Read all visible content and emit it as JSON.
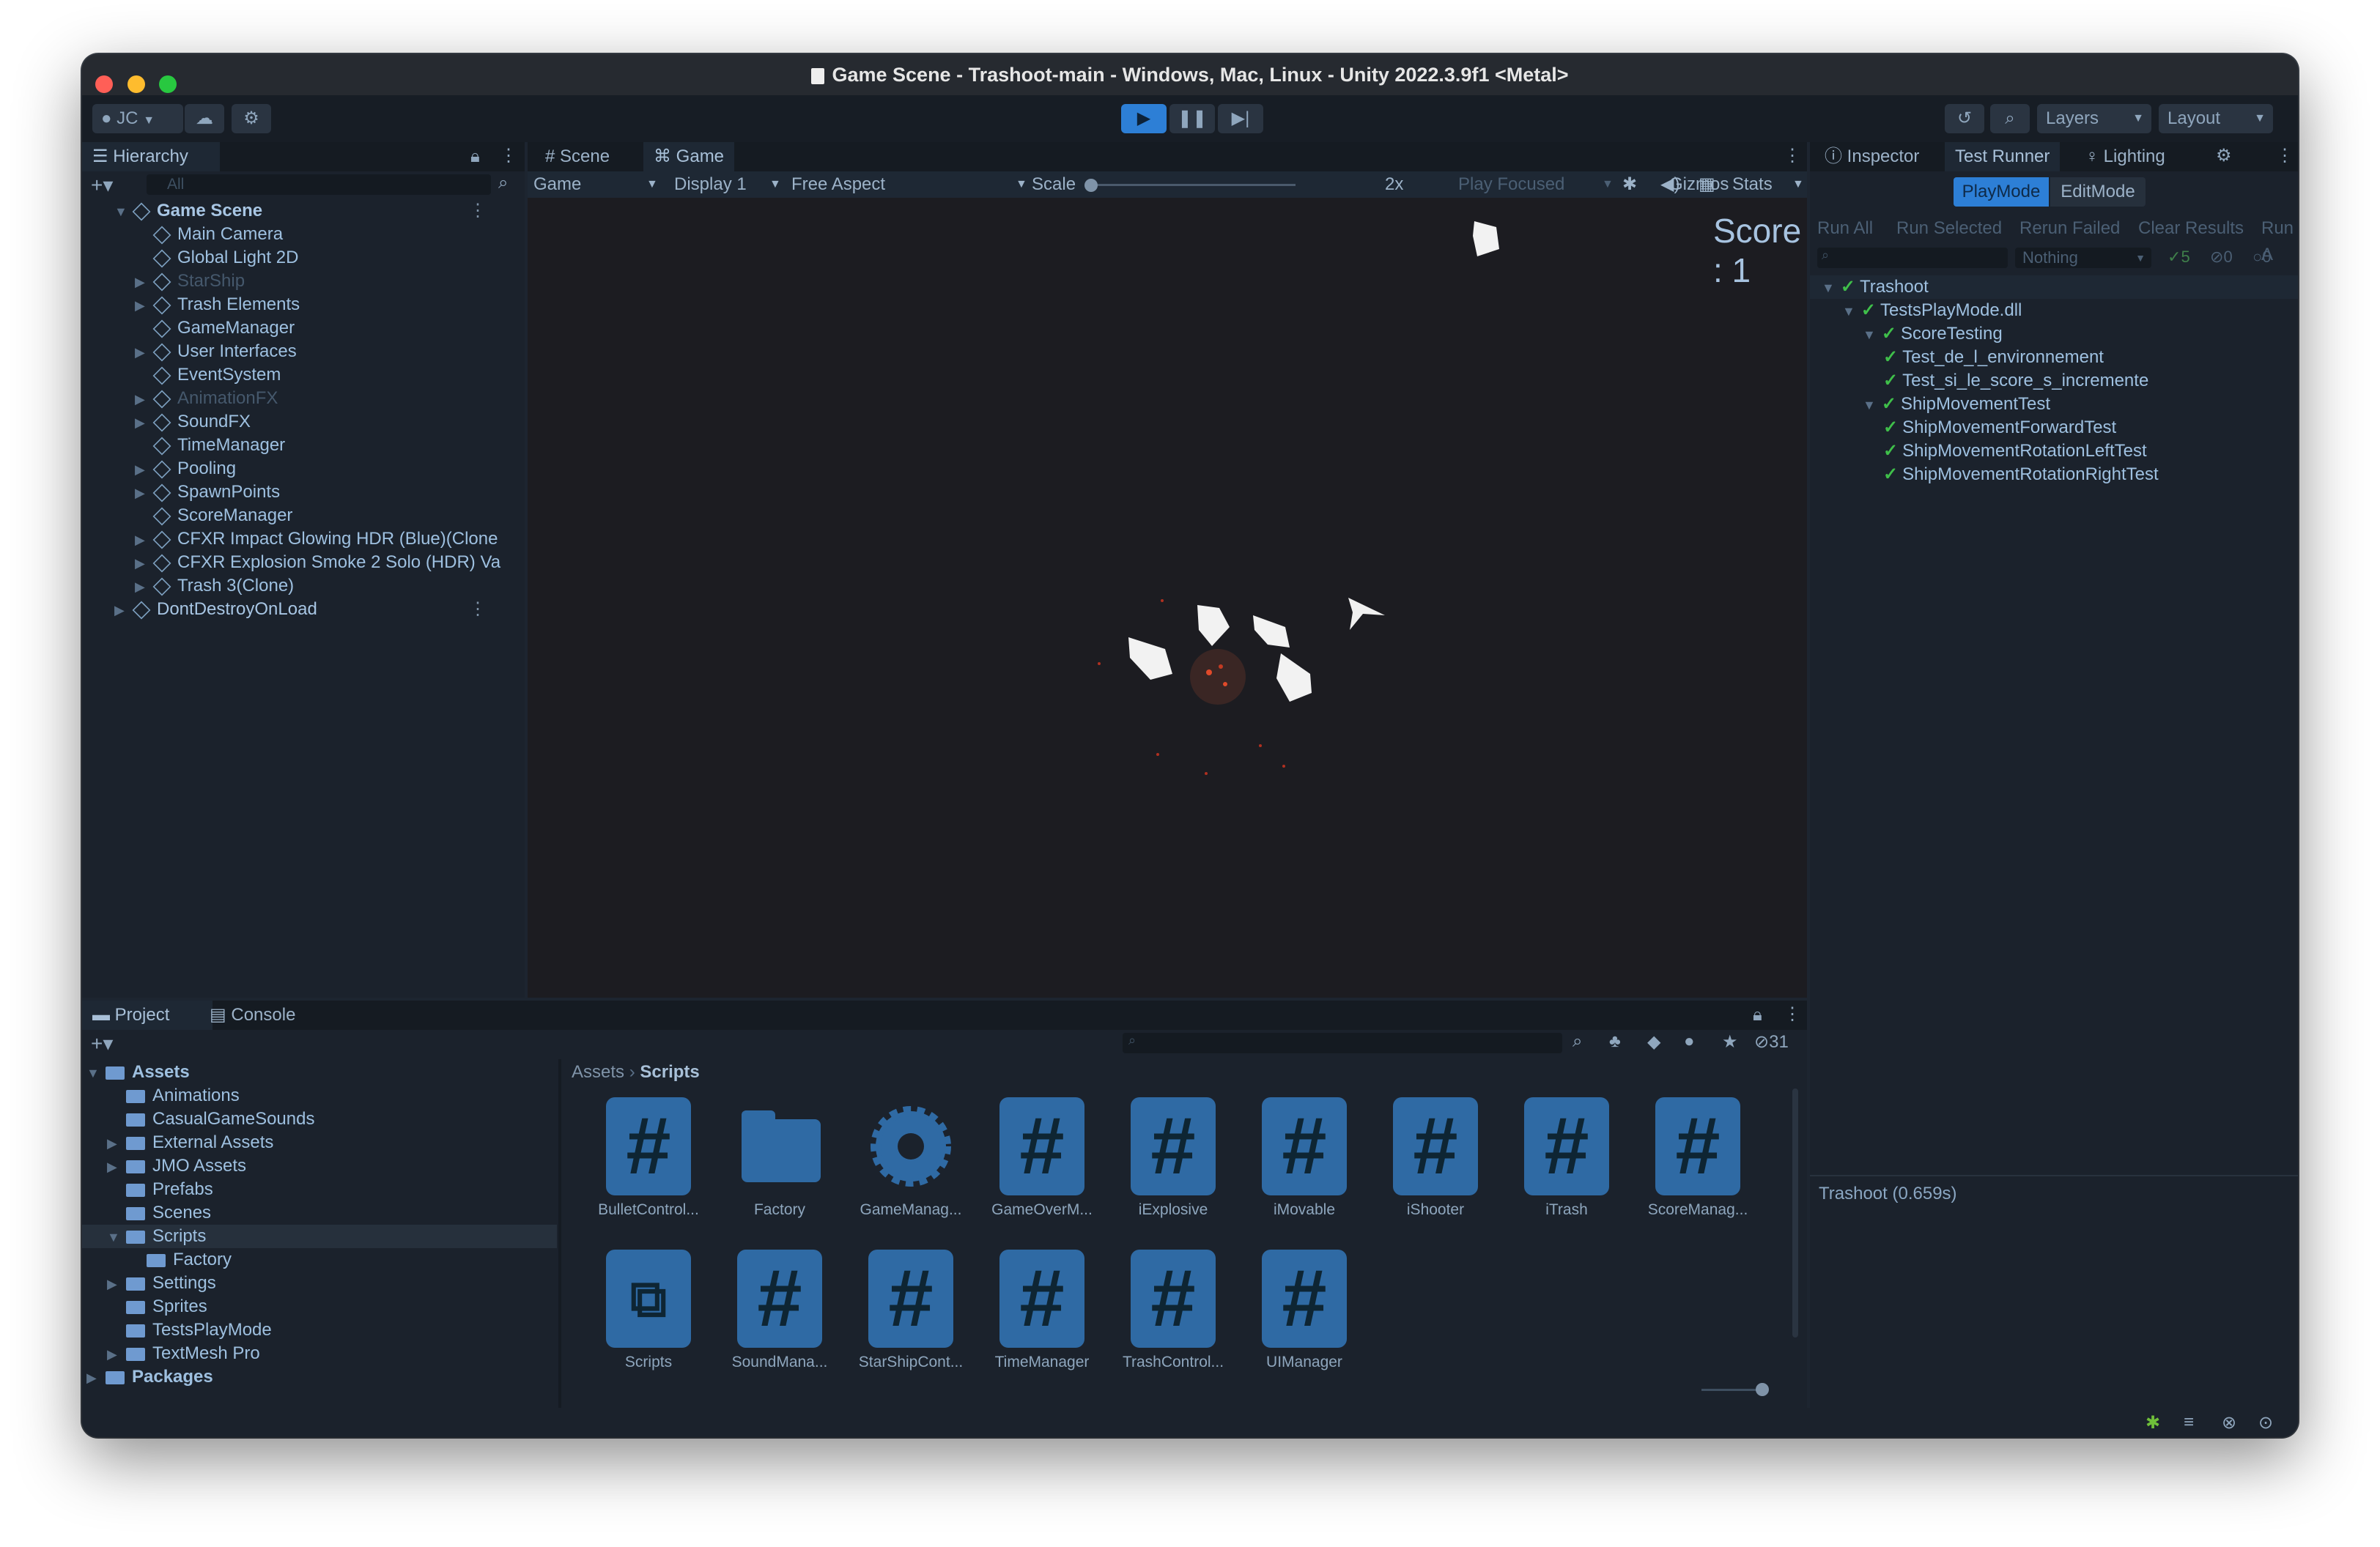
{
  "window": {
    "title": "Game Scene - Trashoot-main - Windows, Mac, Linux - Unity 2022.3.9f1 <Metal>"
  },
  "toolbar": {
    "account": "JC",
    "layers": "Layers",
    "layout": "Layout"
  },
  "hierarchy": {
    "tab": "Hierarchy",
    "search_placeholder": "All",
    "items": [
      {
        "label": "Game Scene",
        "depth": 0,
        "bold": true,
        "dim": false
      },
      {
        "label": "Main Camera",
        "depth": 1,
        "dim": false
      },
      {
        "label": "Global Light 2D",
        "depth": 1,
        "dim": false
      },
      {
        "label": "StarShip",
        "depth": 1,
        "dim": true
      },
      {
        "label": "Trash Elements",
        "depth": 1,
        "dim": false
      },
      {
        "label": "GameManager",
        "depth": 1,
        "dim": false
      },
      {
        "label": "User Interfaces",
        "depth": 1,
        "dim": false
      },
      {
        "label": "EventSystem",
        "depth": 1,
        "dim": false
      },
      {
        "label": "AnimationFX",
        "depth": 1,
        "dim": true
      },
      {
        "label": "SoundFX",
        "depth": 1,
        "dim": false
      },
      {
        "label": "TimeManager",
        "depth": 1,
        "dim": false
      },
      {
        "label": "Pooling",
        "depth": 1,
        "dim": false
      },
      {
        "label": "SpawnPoints",
        "depth": 1,
        "dim": false
      },
      {
        "label": "ScoreManager",
        "depth": 1,
        "dim": false
      },
      {
        "label": "CFXR Impact Glowing HDR (Blue)(Clone",
        "depth": 1,
        "dim": false
      },
      {
        "label": "CFXR Explosion Smoke 2 Solo (HDR) Va",
        "depth": 1,
        "dim": false
      },
      {
        "label": "Trash 3(Clone)",
        "depth": 1,
        "dim": false
      },
      {
        "label": "DontDestroyOnLoad",
        "depth": 0,
        "dim": false
      }
    ]
  },
  "scene_tabs": {
    "scene": "Scene",
    "game": "Game"
  },
  "game_toolbar": {
    "mode": "Game",
    "display": "Display 1",
    "aspect": "Free Aspect",
    "scale_label": "Scale",
    "scale_value": "2x",
    "play_focused": "Play Focused",
    "stats": "Stats",
    "gizmos": "Gizmos"
  },
  "game_view": {
    "score": "Score : 1"
  },
  "inspector": {
    "tabs": [
      "Inspector",
      "Test Runner",
      "Lighting"
    ],
    "mode_playmode": "PlayMode",
    "mode_editmode": "EditMode",
    "actions": [
      "Run All",
      "Run Selected",
      "Rerun Failed",
      "Clear Results",
      "Run A"
    ],
    "filter": "Nothing",
    "passed_count": "5",
    "failed_count": "0",
    "skipped_count": "0",
    "tests": [
      {
        "label": "Trashoot",
        "depth": 0
      },
      {
        "label": "TestsPlayMode.dll",
        "depth": 1
      },
      {
        "label": "ScoreTesting",
        "depth": 2
      },
      {
        "label": "Test_de_l_environnement",
        "depth": 3
      },
      {
        "label": "Test_si_le_score_s_incremente",
        "depth": 3
      },
      {
        "label": "ShipMovementTest",
        "depth": 2
      },
      {
        "label": "ShipMovementForwardTest",
        "depth": 3
      },
      {
        "label": "ShipMovementRotationLeftTest",
        "depth": 3
      },
      {
        "label": "ShipMovementRotationRightTest",
        "depth": 3
      }
    ],
    "result": "Trashoot (0.659s)"
  },
  "project": {
    "tabs": [
      "Project",
      "Console"
    ],
    "hidden_count": "31",
    "tree": [
      {
        "label": "Assets",
        "depth": 0,
        "bold": true
      },
      {
        "label": "Animations",
        "depth": 1
      },
      {
        "label": "CasualGameSounds",
        "depth": 1
      },
      {
        "label": "External Assets",
        "depth": 1
      },
      {
        "label": "JMO Assets",
        "depth": 1
      },
      {
        "label": "Prefabs",
        "depth": 1
      },
      {
        "label": "Scenes",
        "depth": 1
      },
      {
        "label": "Scripts",
        "depth": 1,
        "selected": true
      },
      {
        "label": "Factory",
        "depth": 2
      },
      {
        "label": "Settings",
        "depth": 1
      },
      {
        "label": "Sprites",
        "depth": 1
      },
      {
        "label": "TestsPlayMode",
        "depth": 1
      },
      {
        "label": "TextMesh Pro",
        "depth": 1
      },
      {
        "label": "Packages",
        "depth": 0,
        "bold": true
      }
    ],
    "breadcrumb": [
      "Assets",
      "Scripts"
    ],
    "assets": [
      {
        "label": "BulletControl...",
        "kind": "script"
      },
      {
        "label": "Factory",
        "kind": "folder"
      },
      {
        "label": "GameManag...",
        "kind": "gear"
      },
      {
        "label": "GameOverM...",
        "kind": "script"
      },
      {
        "label": "iExplosive",
        "kind": "script"
      },
      {
        "label": "iMovable",
        "kind": "script"
      },
      {
        "label": "iShooter",
        "kind": "script"
      },
      {
        "label": "iTrash",
        "kind": "script"
      },
      {
        "label": "ScoreManag...",
        "kind": "script"
      },
      {
        "label": "Scripts",
        "kind": "asmdef"
      },
      {
        "label": "SoundMana...",
        "kind": "script"
      },
      {
        "label": "StarShipCont...",
        "kind": "script"
      },
      {
        "label": "TimeManager",
        "kind": "script"
      },
      {
        "label": "TrashControl...",
        "kind": "script"
      },
      {
        "label": "UIManager",
        "kind": "script"
      }
    ]
  },
  "colors": {
    "accent": "#2d7fd6",
    "pass": "#3fbf4a",
    "panel": "#1b222c",
    "game_bg": "#1c1c21"
  }
}
